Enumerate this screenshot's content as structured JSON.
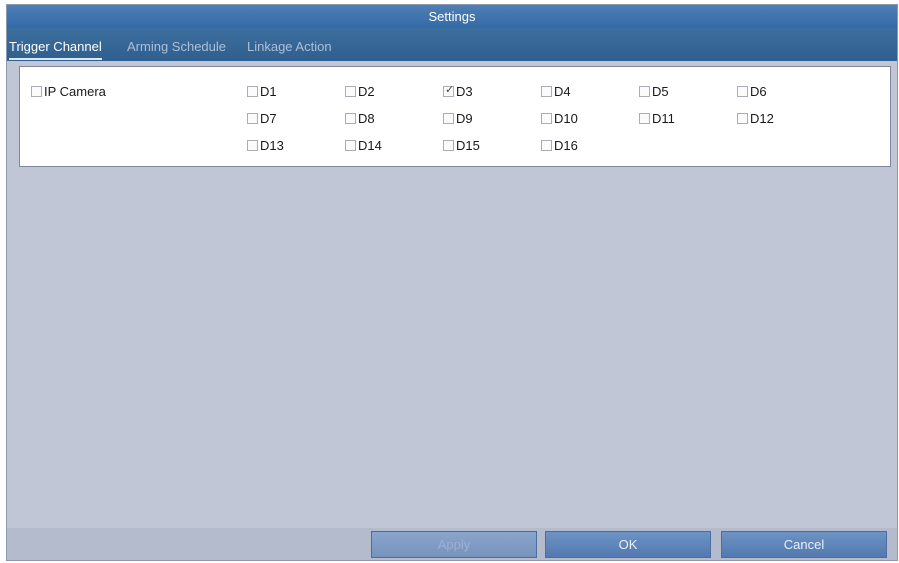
{
  "dialog": {
    "title": "Settings"
  },
  "tabs": [
    {
      "label": "Trigger Channel",
      "active": true
    },
    {
      "label": "Arming Schedule",
      "active": false
    },
    {
      "label": "Linkage Action",
      "active": false
    }
  ],
  "ip_camera": {
    "label": "IP Camera",
    "checked": false
  },
  "channels": [
    {
      "label": "D1",
      "checked": false
    },
    {
      "label": "D2",
      "checked": false
    },
    {
      "label": "D3",
      "checked": true
    },
    {
      "label": "D4",
      "checked": false
    },
    {
      "label": "D5",
      "checked": false
    },
    {
      "label": "D6",
      "checked": false
    },
    {
      "label": "D7",
      "checked": false
    },
    {
      "label": "D8",
      "checked": false
    },
    {
      "label": "D9",
      "checked": false
    },
    {
      "label": "D10",
      "checked": false
    },
    {
      "label": "D11",
      "checked": false
    },
    {
      "label": "D12",
      "checked": false
    },
    {
      "label": "D13",
      "checked": false
    },
    {
      "label": "D14",
      "checked": false
    },
    {
      "label": "D15",
      "checked": false
    },
    {
      "label": "D16",
      "checked": false
    }
  ],
  "footer": {
    "apply_label": "Apply",
    "ok_label": "OK",
    "cancel_label": "Cancel"
  },
  "icons": {
    "checkmark": "check-icon"
  }
}
